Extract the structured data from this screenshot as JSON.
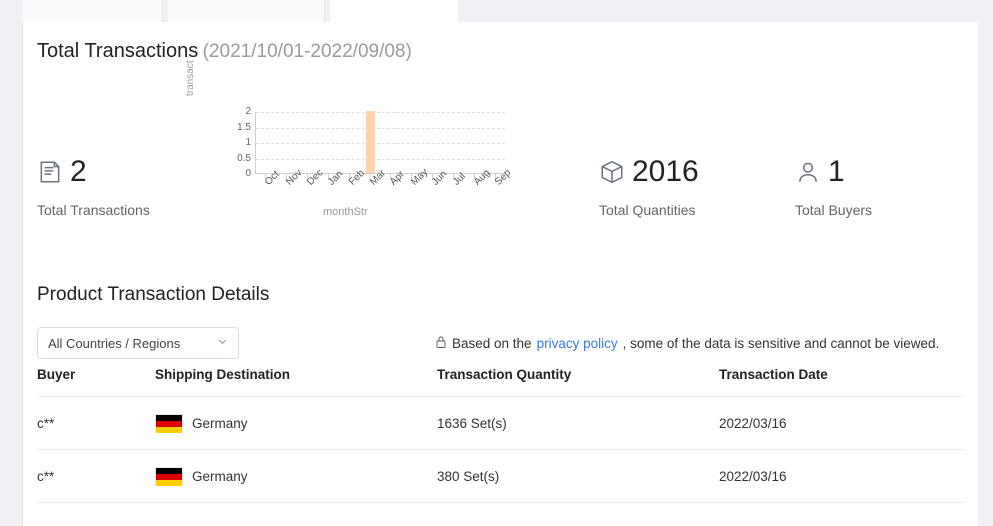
{
  "tabs": [
    {
      "label": "",
      "active": false,
      "left": 22,
      "width": 141
    },
    {
      "label": "",
      "active": false,
      "left": 168,
      "width": 157
    },
    {
      "label": "",
      "active": true,
      "left": 330,
      "width": 128
    }
  ],
  "header": {
    "title": "Total Transactions",
    "date_range": "(2021/10/01-2022/09/08)"
  },
  "chart_data": {
    "type": "bar",
    "title": "",
    "xlabel": "monthStr",
    "ylabel": "transact",
    "categories": [
      "Oct",
      "Nov",
      "Dec",
      "Jan",
      "Feb",
      "Mar",
      "Apr",
      "May",
      "Jun",
      "Jul",
      "Aug",
      "Sep"
    ],
    "values": [
      0,
      0,
      0,
      0,
      0,
      2,
      0,
      0,
      0,
      0,
      0,
      0
    ],
    "ylim": [
      0,
      2
    ],
    "yticks": [
      "2",
      "1.5",
      "1",
      "0.5",
      "0"
    ],
    "grid": true,
    "legend": "none",
    "bar_color": "#ffd4ad"
  },
  "stats": [
    {
      "icon": "document-icon",
      "value": "2",
      "label": "Total Transactions"
    },
    {
      "icon": "box-icon",
      "value": "2016",
      "label": "Total Quantities"
    },
    {
      "icon": "user-icon",
      "value": "1",
      "label": "Total Buyers"
    }
  ],
  "details": {
    "title": "Product Transaction Details",
    "country_filter": {
      "selected": "All Countries / Regions"
    },
    "privacy_note": {
      "prefix": "Based on the ",
      "link": "privacy policy",
      "suffix": ", some of the data is sensitive and cannot be viewed."
    },
    "columns": [
      "Buyer",
      "Shipping Destination",
      "Transaction Quantity",
      "Transaction Date"
    ],
    "rows": [
      {
        "buyer": "c**",
        "destination": "Germany",
        "quantity": "1636 Set(s)",
        "date": "2022/03/16"
      },
      {
        "buyer": "c**",
        "destination": "Germany",
        "quantity": "380 Set(s)",
        "date": "2022/03/16"
      }
    ]
  }
}
